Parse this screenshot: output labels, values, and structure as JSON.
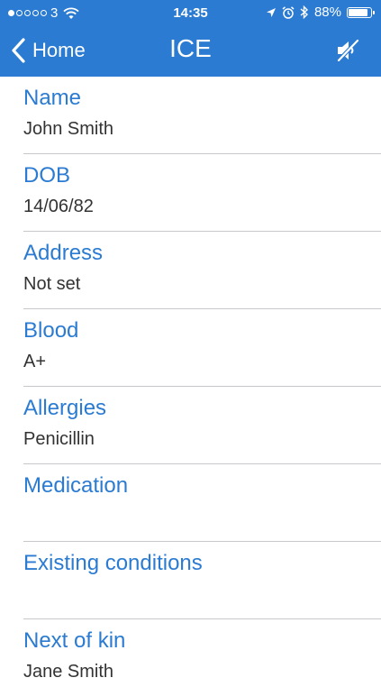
{
  "status_bar": {
    "carrier": "3",
    "time": "14:35",
    "battery_text": "88%",
    "battery_level": 0.88,
    "signal_bars_filled": 1,
    "signal_bars_total": 5
  },
  "nav": {
    "back_label": "Home",
    "title": "ICE",
    "right_icon": "mute-icon"
  },
  "fields": [
    {
      "label": "Name",
      "value": "John Smith"
    },
    {
      "label": "DOB",
      "value": "14/06/82"
    },
    {
      "label": "Address",
      "value": "Not set"
    },
    {
      "label": "Blood",
      "value": "A+"
    },
    {
      "label": "Allergies",
      "value": "Penicillin"
    },
    {
      "label": "Medication",
      "value": ""
    },
    {
      "label": "Existing conditions",
      "value": ""
    },
    {
      "label": "Next of kin",
      "value": "Jane Smith"
    }
  ],
  "colors": {
    "header": "#2a7bd1",
    "label": "#2a7bd1",
    "value": "#333333",
    "separator": "#c8c8cc"
  }
}
